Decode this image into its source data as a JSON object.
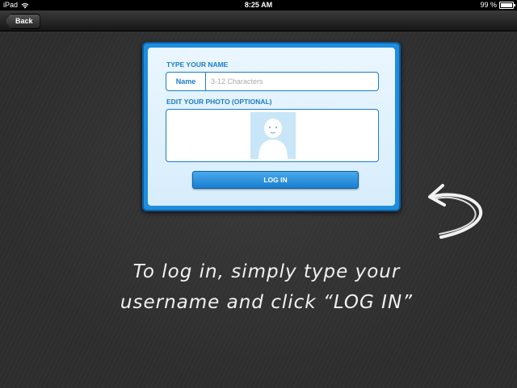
{
  "status_bar": {
    "carrier": "iPad",
    "time": "8:25 AM",
    "battery": "99 %",
    "battery_level": 0.99
  },
  "nav_bar": {
    "back_label": "Back"
  },
  "login": {
    "name_section_title": "TYPE YOUR NAME",
    "name_label": "Name",
    "name_placeholder": "3-12 Characters",
    "name_value": "",
    "photo_section_title": "EDIT YOUR PHOTO (OPTIONAL)",
    "login_button_label": "LOG IN"
  },
  "instructions": {
    "line1": "To log in, simply type your",
    "line2": "username and click “LOG IN”"
  },
  "colors": {
    "panel_border": "#1f8ddc",
    "accent": "#1a7dc9",
    "chalkboard": "#2e2e2e"
  }
}
